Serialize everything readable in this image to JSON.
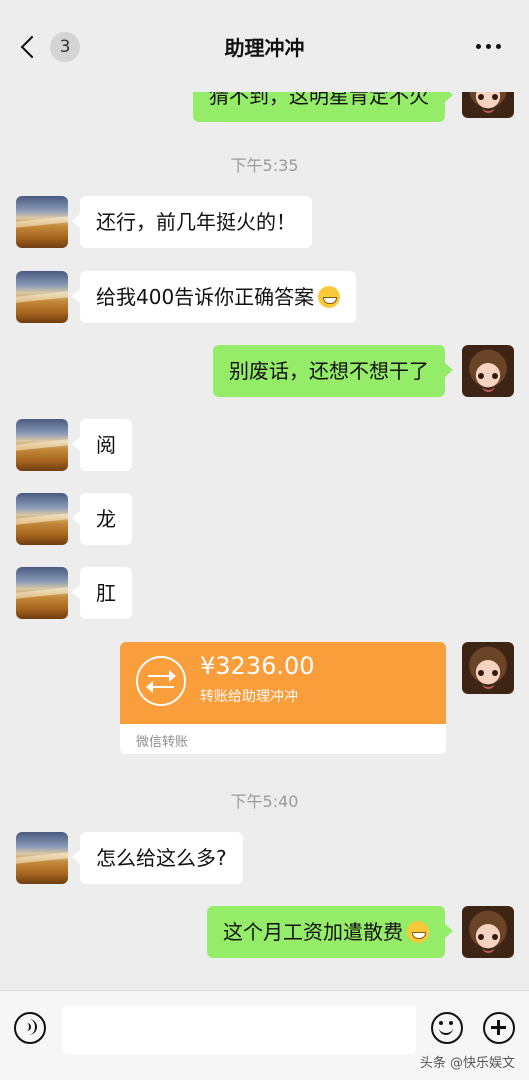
{
  "header": {
    "back_count": "3",
    "title": "助理冲冲"
  },
  "messages": {
    "m1": "猜不到，这明星肯定不火",
    "ts1": "下午5:35",
    "m2": "还行，前几年挺火的！",
    "m3": "给我400告诉你正确答案",
    "m4": "别废话，还想不想干了",
    "m5": "阅",
    "m6": "龙",
    "m7": "肛",
    "ts2": "下午5:40",
    "m8": "怎么给这么多?",
    "m9": "这个月工资加遣散费"
  },
  "transfer": {
    "amount": "¥3236.00",
    "description": "转账给助理冲冲",
    "label": "微信转账",
    "icon": "transfer-arrows-icon",
    "color": "#fa9d3b"
  },
  "input_bar": {
    "placeholder": "",
    "voice_icon": "voice-icon",
    "emoji_icon": "emoji-icon",
    "plus_icon": "plus-icon"
  },
  "watermark": "头条 @快乐娱文",
  "colors": {
    "background": "#ededed",
    "sent_bubble": "#95ec69",
    "received_bubble": "#ffffff"
  }
}
